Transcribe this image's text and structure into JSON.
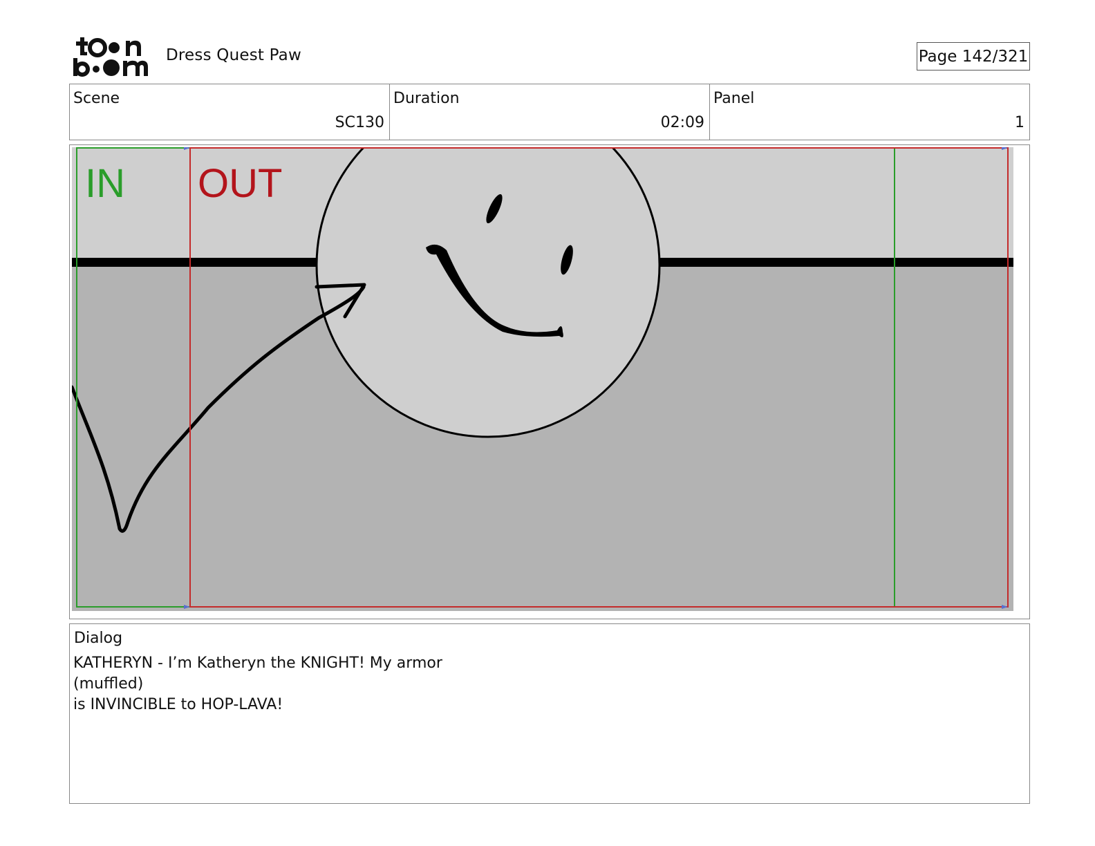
{
  "header": {
    "logo_text": "toon boom",
    "project_title": "Dress Quest Paw",
    "page_label": "Page 142/321"
  },
  "info": {
    "scene": {
      "label": "Scene",
      "value": "SC130"
    },
    "duration": {
      "label": "Duration",
      "value": "02:09"
    },
    "panel": {
      "label": "Panel",
      "value": "1"
    }
  },
  "panel_image": {
    "in_label": "IN",
    "out_label": "OUT",
    "colors": {
      "sky": "#cfcfcf",
      "ground": "#b3b3b3",
      "in_color": "#2a9d2a",
      "out_color": "#b3141b",
      "ink": "#000000"
    }
  },
  "dialog": {
    "label": "Dialog",
    "lines": [
      "KATHERYN - I’m Katheryn the KNIGHT! My armor",
      "(muffled)",
      "is INVINCIBLE to HOP-LAVA!"
    ]
  }
}
